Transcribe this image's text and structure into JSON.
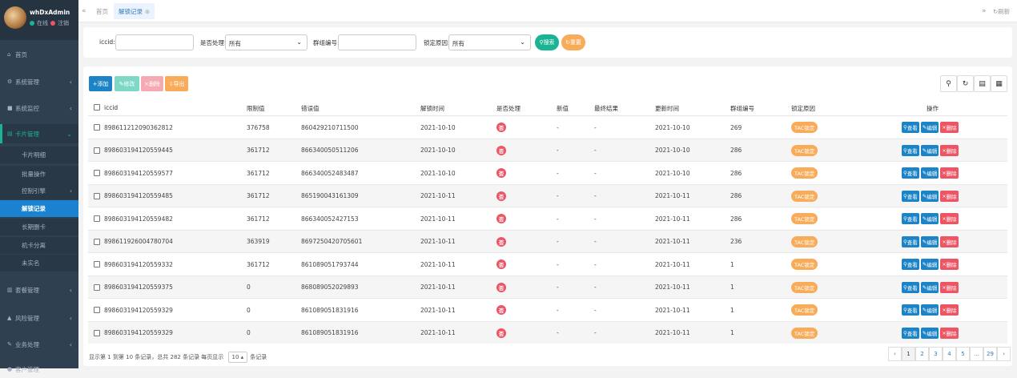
{
  "sidebar": {
    "username": "whDxAdmin",
    "online": "在线",
    "logout": "注销",
    "nav": [
      {
        "label": "首页"
      },
      {
        "label": "系统管理"
      },
      {
        "label": "系统监控"
      },
      {
        "label": "卡片管理"
      }
    ],
    "subs": [
      {
        "label": "卡片明细"
      },
      {
        "label": "批量操作"
      },
      {
        "label": "控制引擎"
      },
      {
        "label": "解锁记录"
      },
      {
        "label": "长期删卡"
      },
      {
        "label": "机卡分离"
      },
      {
        "label": "未实名"
      }
    ],
    "nav2": [
      {
        "label": "套餐管理"
      },
      {
        "label": "风险管理"
      },
      {
        "label": "业务处理"
      },
      {
        "label": "客户管理"
      }
    ]
  },
  "topbar": {
    "home": "首页",
    "tab": "解锁记录",
    "refresh": "刷新"
  },
  "search": {
    "iccid_label": "iccid:",
    "handled_label": "是否处理:",
    "handled_value": "所有",
    "group_label": "群组编号:",
    "reason_label": "锁定原因:",
    "reason_value": "所有",
    "search_btn": "搜索",
    "reset_btn": "重置"
  },
  "toolbar": {
    "add": "添加",
    "edit": "修改",
    "delete": "删除",
    "export": "导出"
  },
  "table": {
    "headers": [
      "iccid",
      "限制值",
      "错误值",
      "解锁时间",
      "是否处理",
      "新值",
      "最终结果",
      "更新时间",
      "群组编号",
      "锁定原因",
      "操作"
    ],
    "rows": [
      [
        "898611212090362812",
        "376758",
        "860429210711500",
        "2021-10-10",
        "否",
        "-",
        "-",
        "2021-10-10",
        "269",
        "TAC锁定"
      ],
      [
        "898603194120559445",
        "361712",
        "866340050511206",
        "2021-10-10",
        "否",
        "-",
        "-",
        "2021-10-10",
        "286",
        "TAC锁定"
      ],
      [
        "898603194120559577",
        "361712",
        "866340052483487",
        "2021-10-10",
        "否",
        "-",
        "-",
        "2021-10-10",
        "286",
        "TAC锁定"
      ],
      [
        "898603194120559485",
        "361712",
        "865190043161309",
        "2021-10-11",
        "否",
        "-",
        "-",
        "2021-10-11",
        "286",
        "TAC锁定"
      ],
      [
        "898603194120559482",
        "361712",
        "866340052427153",
        "2021-10-11",
        "否",
        "-",
        "-",
        "2021-10-11",
        "286",
        "TAC锁定"
      ],
      [
        "898611926004780704",
        "363919",
        "869725042070560​1",
        "2021-10-11",
        "否",
        "-",
        "-",
        "2021-10-11",
        "236",
        "TAC锁定"
      ],
      [
        "898603194120559332",
        "361712",
        "861089051793744",
        "2021-10-11",
        "否",
        "-",
        "-",
        "2021-10-11",
        "1",
        "TAC锁定"
      ],
      [
        "898603194120559375",
        "0",
        "868089052029893",
        "2021-10-11",
        "否",
        "-",
        "-",
        "2021-10-11",
        "1",
        "TAC锁定"
      ],
      [
        "898603194120559329",
        "0",
        "861089051831916",
        "2021-10-11",
        "否",
        "-",
        "-",
        "2021-10-11",
        "1",
        "TAC锁定"
      ],
      [
        "898603194120559329",
        "0",
        "861089051831916",
        "2021-10-11",
        "否",
        "-",
        "-",
        "2021-10-11",
        "1",
        "TAC锁定"
      ]
    ],
    "ops": {
      "view": "查看",
      "edit": "编辑",
      "delete": "删除"
    }
  },
  "footer": {
    "info": "显示第 1 到第 10 条记录，总共 282 条记录 每页显示",
    "page_size": "10",
    "suffix": "条记录"
  },
  "pagination": [
    "‹",
    "1",
    "2",
    "3",
    "4",
    "5",
    "...",
    "29",
    "›"
  ],
  "colors": {
    "sidebar": "#2f4050",
    "primary": "#1ab394",
    "blue": "#1c84c6",
    "red": "#ed5565",
    "orange": "#f8ac59"
  }
}
